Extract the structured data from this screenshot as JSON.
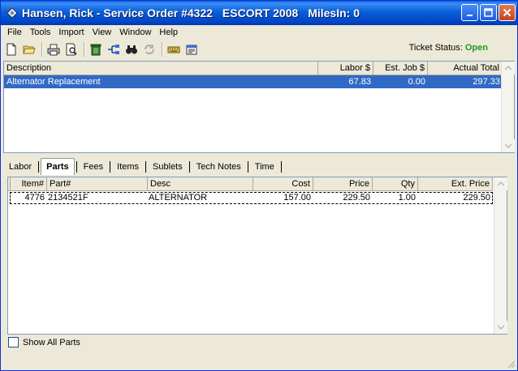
{
  "window": {
    "title_parts": [
      "Hansen, Rick - Service Order #4322",
      "ESCORT 2008",
      "MilesIn: 0"
    ]
  },
  "menu": [
    "File",
    "Tools",
    "Import",
    "View",
    "Window",
    "Help"
  ],
  "toolbar": {
    "icons": [
      "new-document-icon",
      "open-folder-icon",
      "print-icon",
      "print-preview-icon",
      "trash-icon",
      "tree-icon",
      "binoculars-icon",
      "refresh-icon",
      "keyboard-icon",
      "properties-icon"
    ]
  },
  "ticket_status": {
    "label": "Ticket Status:",
    "value": "Open",
    "value_color": "#1b9b1b"
  },
  "jobs": {
    "columns": [
      "Description",
      "Labor $",
      "Est. Job $",
      "Actual Total"
    ],
    "rows": [
      {
        "description": "Alternator Replacement",
        "labor": "67.83",
        "est_job": "0.00",
        "actual_total": "297.33"
      }
    ],
    "selected_color": "#316ac5"
  },
  "tabs": [
    "Labor",
    "Parts",
    "Fees",
    "Items",
    "Sublets",
    "Tech Notes",
    "Time"
  ],
  "active_tab": "Parts",
  "parts": {
    "columns": [
      "Item#",
      "Part#",
      "Desc",
      "Cost",
      "Price",
      "Qty",
      "Ext. Price"
    ],
    "rows": [
      {
        "item": "4776",
        "part": "2134521F",
        "desc": "ALTERNATOR",
        "cost": "157.00",
        "price": "229.50",
        "qty": "1.00",
        "ext_price": "229.50"
      }
    ]
  },
  "show_all_parts": {
    "label": "Show All Parts",
    "checked": false
  }
}
